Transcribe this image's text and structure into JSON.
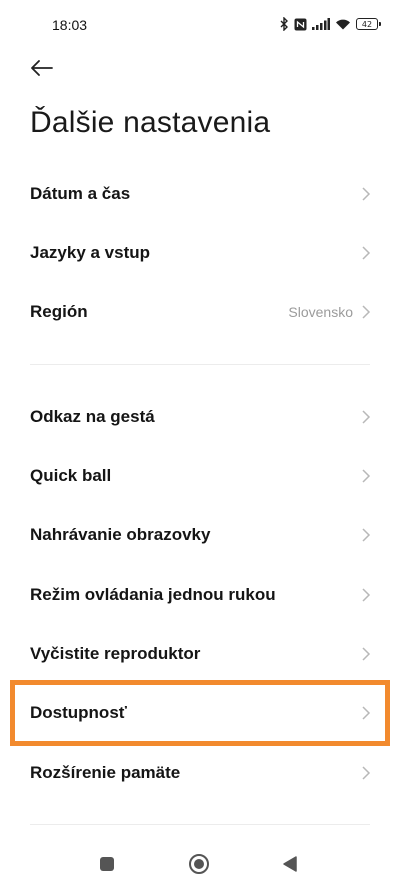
{
  "status_bar": {
    "time": "18:03",
    "battery": "42",
    "icons": [
      "bluetooth-icon",
      "nfc-icon",
      "signal-icon",
      "wifi-icon",
      "battery-icon"
    ]
  },
  "header": {
    "back_icon": "arrow-left-icon",
    "title": "Ďalšie nastavenia"
  },
  "groups": [
    {
      "items": [
        {
          "label": "Dátum a čas",
          "value": ""
        },
        {
          "label": "Jazyky a vstup",
          "value": ""
        },
        {
          "label": "Región",
          "value": "Slovensko"
        }
      ]
    },
    {
      "items": [
        {
          "label": "Odkaz na gestá",
          "value": ""
        },
        {
          "label": "Quick ball",
          "value": ""
        },
        {
          "label": "Nahrávanie obrazovky",
          "value": ""
        },
        {
          "label": "Režim ovládania jednou rukou",
          "value": ""
        },
        {
          "label": "Vyčistite reproduktor",
          "value": ""
        },
        {
          "label": "Dostupnosť",
          "value": "",
          "highlighted": true
        },
        {
          "label": "Rozšírenie pamäte",
          "value": ""
        }
      ]
    }
  ],
  "highlight_color": "#f28a2e",
  "nav_bar": {
    "icons": [
      "recents-square-icon",
      "home-circle-icon",
      "back-triangle-icon"
    ]
  }
}
